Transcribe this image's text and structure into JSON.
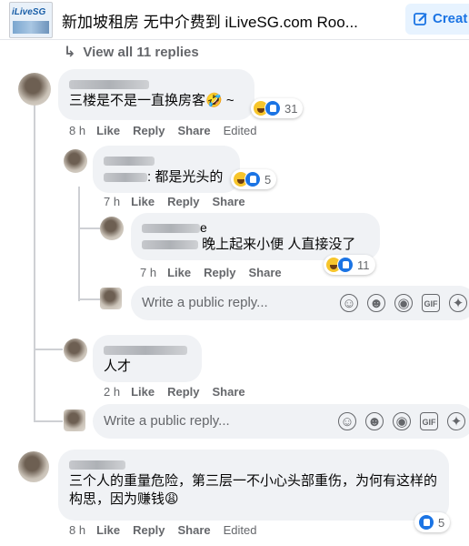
{
  "header": {
    "logo_text": "iLiveSG",
    "group_title": "新加坡租房 无中介费到 iLiveSG.com Roo...",
    "create_label": "Creat"
  },
  "view_all": "View all 11 replies",
  "comments": [
    {
      "text": "三楼是不是一直换房客🤣 ~",
      "time": "8 h",
      "like": "Like",
      "reply": "Reply",
      "share": "Share",
      "edited": "Edited",
      "reactions": "31"
    },
    {
      "text": ": 都是光头的",
      "time": "7 h",
      "like": "Like",
      "reply": "Reply",
      "share": "Share",
      "reactions": "5"
    },
    {
      "name_tail": "e",
      "text": "晚上起来小便 人直接没了",
      "time": "7 h",
      "like": "Like",
      "reply": "Reply",
      "share": "Share",
      "reactions": "11"
    },
    {
      "text": "人才",
      "time": "2 h",
      "like": "Like",
      "reply": "Reply",
      "share": "Share"
    },
    {
      "text": "三个人的重量危险，第三层一不小心头部重伤，为何有这样的构思，因为赚钱😩",
      "time": "8 h",
      "like": "Like",
      "reply": "Reply",
      "share": "Share",
      "edited": "Edited",
      "reactions": "5"
    }
  ],
  "reply_placeholder": "Write a public reply...",
  "icons": {
    "sticker": "sticker-icon",
    "emoji": "emoji-icon",
    "camera": "camera-icon",
    "gif": "gif-icon",
    "gif_label": "GIF",
    "stickers2": "avatar-sticker-icon"
  },
  "colors": {
    "accent": "#1b74e4",
    "bubble": "#f0f2f5",
    "muted": "#65676b"
  }
}
